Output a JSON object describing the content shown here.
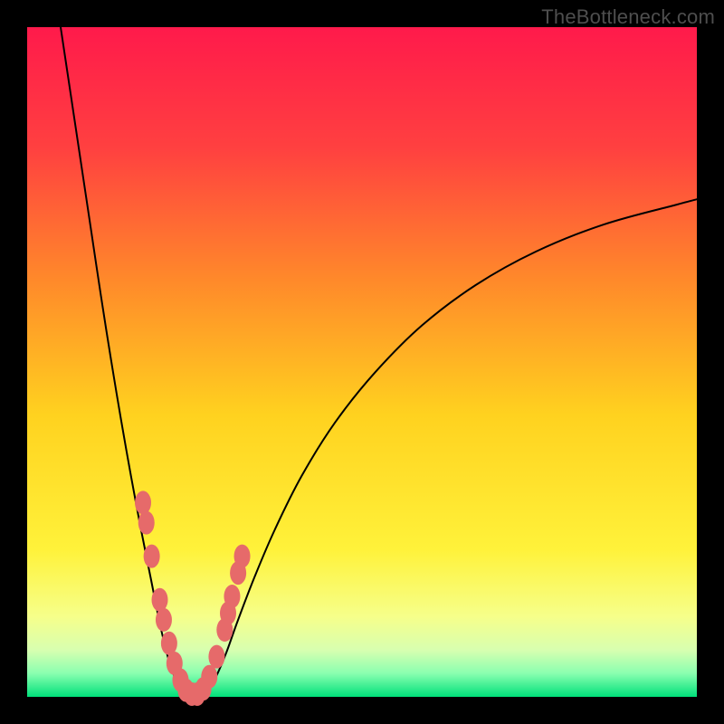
{
  "watermark": "TheBottleneck.com",
  "colors": {
    "frame": "#000000",
    "curve_stroke": "#000000",
    "marker_fill": "#e66a6a",
    "marker_stroke": "#cf5a5a",
    "gradient_stops": [
      {
        "offset": 0.0,
        "color": "#ff1a4b"
      },
      {
        "offset": 0.18,
        "color": "#ff4040"
      },
      {
        "offset": 0.38,
        "color": "#ff8a2a"
      },
      {
        "offset": 0.58,
        "color": "#ffd21f"
      },
      {
        "offset": 0.78,
        "color": "#fff23a"
      },
      {
        "offset": 0.88,
        "color": "#f6ff8a"
      },
      {
        "offset": 0.93,
        "color": "#d8ffb0"
      },
      {
        "offset": 0.965,
        "color": "#8affb0"
      },
      {
        "offset": 1.0,
        "color": "#00e07a"
      }
    ]
  },
  "plot_css_gradient": "background: linear-gradient(to bottom, #ff1a4b 0%, #ff4040 18%, #ff8a2a 38%, #ffd21f 58%, #fff23a 78%, #f6ff8a 88%, #d8ffb0 93%, #8affb0 96.5%, #00e07a 100%);",
  "chart_data": {
    "type": "line",
    "title": "",
    "xlabel": "",
    "ylabel": "",
    "xlim": [
      0,
      100
    ],
    "ylim": [
      0,
      100
    ],
    "grid": false,
    "legend": false,
    "note": "Only visual curve shape, no tick labels or axis titles are present in the image. Values are estimated from a 0–100 normalized coordinate space (0,0 = bottom-left of the gradient area).",
    "series": [
      {
        "name": "left-branch",
        "description": "Steep descending curve from upper-left into the valley floor",
        "x": [
          5.0,
          6.5,
          8.0,
          9.5,
          11.0,
          12.5,
          14.0,
          15.5,
          17.0,
          18.5,
          19.8,
          21.0,
          22.2,
          23.2,
          24.0
        ],
        "y": [
          100.0,
          90.0,
          80.0,
          70.0,
          60.0,
          50.5,
          41.5,
          33.0,
          25.0,
          17.5,
          11.0,
          6.0,
          2.5,
          0.7,
          0.2
        ]
      },
      {
        "name": "right-branch",
        "description": "Curve rising out of the valley floor toward the right edge",
        "x": [
          26.0,
          27.0,
          28.2,
          29.7,
          31.5,
          34.0,
          37.0,
          41.0,
          46.0,
          52.0,
          59.0,
          67.0,
          76.0,
          86.0,
          97.0,
          100.0
        ],
        "y": [
          0.2,
          1.0,
          3.0,
          6.5,
          11.5,
          18.0,
          25.0,
          33.0,
          41.0,
          48.5,
          55.5,
          61.5,
          66.5,
          70.5,
          73.5,
          74.3
        ]
      }
    ],
    "markers": {
      "description": "Clusters of rounded salmon/pink markers near the valley along both branches",
      "points": [
        {
          "x": 17.3,
          "y": 29.0
        },
        {
          "x": 17.8,
          "y": 26.0
        },
        {
          "x": 18.6,
          "y": 21.0
        },
        {
          "x": 19.8,
          "y": 14.5
        },
        {
          "x": 20.4,
          "y": 11.5
        },
        {
          "x": 21.2,
          "y": 8.0
        },
        {
          "x": 22.0,
          "y": 5.0
        },
        {
          "x": 22.9,
          "y": 2.5
        },
        {
          "x": 23.7,
          "y": 1.0
        },
        {
          "x": 24.6,
          "y": 0.4
        },
        {
          "x": 25.4,
          "y": 0.4
        },
        {
          "x": 26.3,
          "y": 1.2
        },
        {
          "x": 27.2,
          "y": 3.0
        },
        {
          "x": 28.3,
          "y": 6.0
        },
        {
          "x": 29.5,
          "y": 10.0
        },
        {
          "x": 30.0,
          "y": 12.5
        },
        {
          "x": 30.6,
          "y": 15.0
        },
        {
          "x": 31.5,
          "y": 18.5
        },
        {
          "x": 32.1,
          "y": 21.0
        }
      ]
    }
  }
}
